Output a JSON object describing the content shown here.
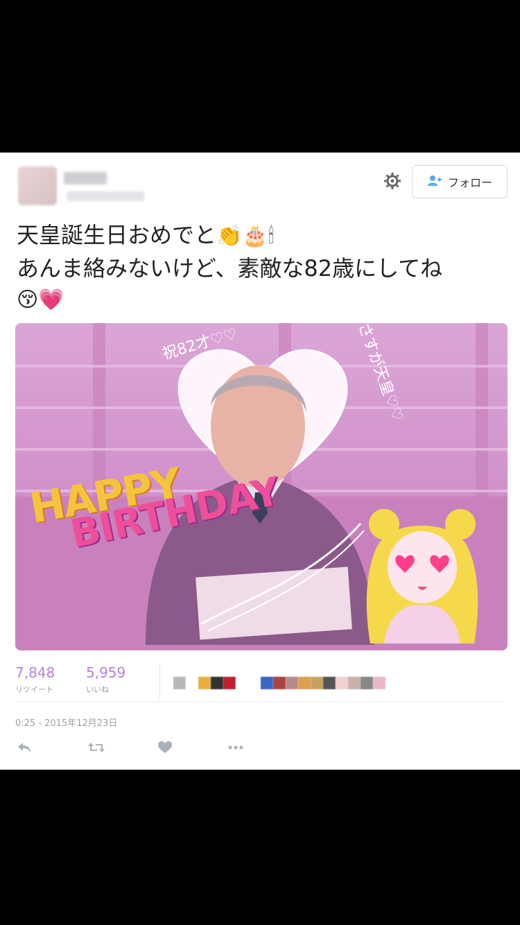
{
  "tweet": {
    "follow_label": "フォロー",
    "text_line1": "天皇誕生日おめでと",
    "text_line1_emoji": "👏🎂🕯",
    "text_line2": "あんま絡みないけど、素敵な82歳にしてね",
    "text_line3_emoji": "😚💗",
    "image": {
      "banner_happy": "HAPPY",
      "banner_birthday": "BIRTHDAY",
      "note1": "祝82才♡♡",
      "note2": "さすが天皇♡♡"
    },
    "retweets_count": "7,848",
    "retweets_label": "リツイート",
    "likes_count": "5,959",
    "likes_label": "いいね",
    "timestamp": "0:25 - 2015年12月23日"
  },
  "colors": {
    "follow_icon": "#55acee",
    "count_color": "#b681d8",
    "card_bg": "#ffffff",
    "page_bg": "#000000"
  },
  "icons": [
    "gear-icon",
    "follow-person-icon",
    "reply-icon",
    "retweet-icon",
    "like-icon",
    "more-icon"
  ]
}
